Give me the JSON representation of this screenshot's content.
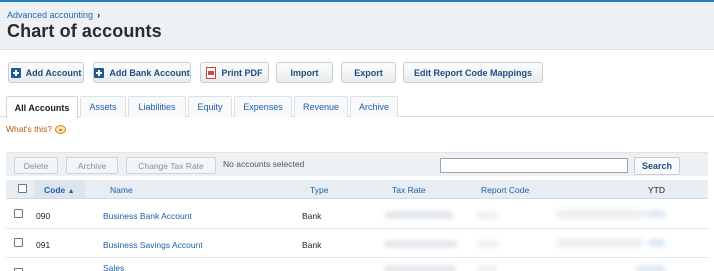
{
  "header": {
    "breadcrumb": "Advanced accounting",
    "title": "Chart of accounts"
  },
  "toolbar": {
    "add_account": "Add Account",
    "add_bank_account": "Add Bank Account",
    "print_pdf": "Print PDF",
    "import": "Import",
    "export": "Export",
    "edit_report_code_mappings": "Edit Report Code Mappings"
  },
  "tabs": [
    "All Accounts",
    "Assets",
    "Liabilities",
    "Equity",
    "Expenses",
    "Revenue",
    "Archive"
  ],
  "help": {
    "whats_this": "What's this?"
  },
  "actions": {
    "delete": "Delete",
    "archive": "Archive",
    "change_tax_rate": "Change Tax Rate",
    "selection_status": "No accounts selected",
    "search_value": "",
    "search_button": "Search"
  },
  "table": {
    "columns": {
      "code": "Code",
      "sort_indicator": "▲",
      "name": "Name",
      "type": "Type",
      "tax_rate": "Tax Rate",
      "report_code": "Report Code",
      "ytd": "YTD"
    },
    "rows": [
      {
        "code": "090",
        "name": "Business Bank Account",
        "type": "Bank"
      },
      {
        "code": "091",
        "name": "Business Savings Account",
        "type": "Bank"
      },
      {
        "code": "",
        "name": "Sales",
        "type": ""
      }
    ]
  },
  "colors": {
    "accent": "#1e5fa8",
    "header_bg": "#eef1f4",
    "help_orange": "#b35a12"
  }
}
